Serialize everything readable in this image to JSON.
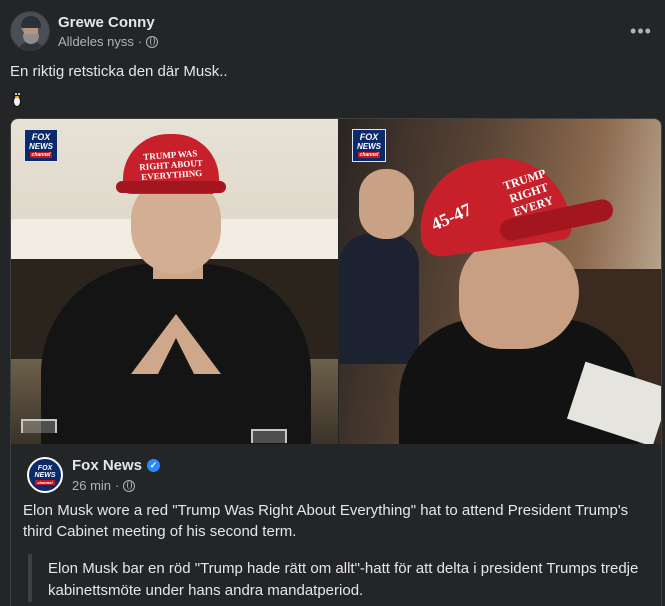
{
  "post": {
    "author": "Grewe Conny",
    "timestamp": "Alldeles nyss",
    "separator": "·",
    "audience_icon": "globe-icon",
    "more_icon": "more-options-icon",
    "more_label": "•••",
    "text": "En riktig retsticka den där Musk..",
    "emoji": "penguin-emoji"
  },
  "shared": {
    "image_left_hat_text": "TRUMP WAS RIGHT ABOUT EVERYTHING",
    "image_right_hat_number": "45-47",
    "image_right_hat_text": "TRUMP RIGHT EVERY",
    "watermark": {
      "line1": "FOX",
      "line2": "NEWS",
      "line3": "channel"
    },
    "source_name": "Fox News",
    "verified_icon": "verified-badge-icon",
    "source_time": "26 min",
    "separator": "·",
    "source_audience_icon": "globe-icon",
    "text": "Elon Musk wore a red \"Trump Was Right About Everything\" hat to attend President Trump's third Cabinet meeting of his second term.",
    "translation": "Elon Musk bar en röd \"Trump hade rätt om allt\"-hatt för att delta i president Trumps tredje kabinettsmöte under hans andra mandatperiod."
  },
  "colors": {
    "background": "#242526",
    "text_primary": "#e4e6eb",
    "text_secondary": "#b0b3b8",
    "border": "#3e4042",
    "fox_blue": "#0a2a6b",
    "hat_red": "#c8202a",
    "verified_blue": "#2d88ff"
  }
}
